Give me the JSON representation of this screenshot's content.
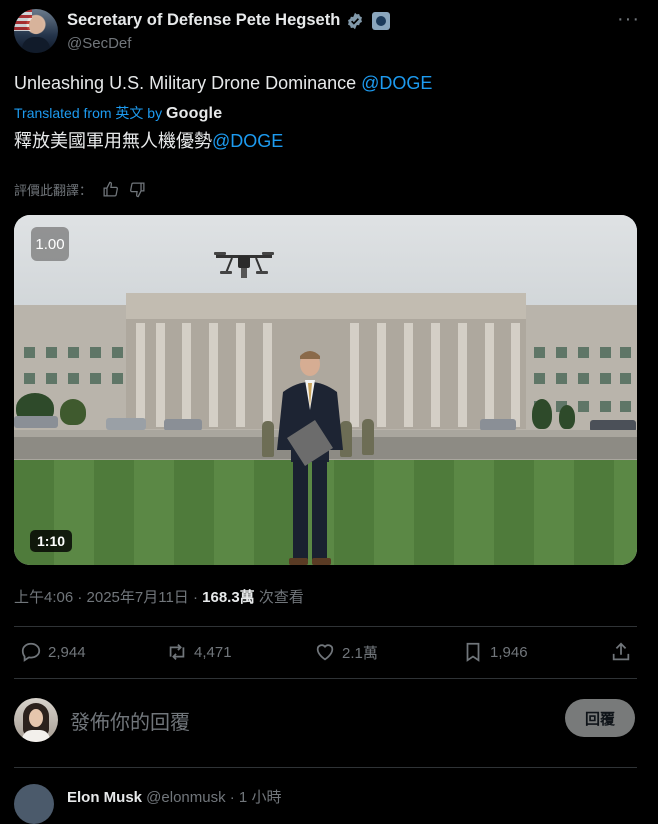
{
  "post": {
    "author_name": "Secretary of Defense Pete Hegseth",
    "author_handle": "@SecDef",
    "more_glyph": "···",
    "text_main": "Unleashing U.S. Military Drone Dominance ",
    "text_mention": "@DOGE",
    "translated_label": "Translated from 英文 by ",
    "translated_brand": "Google",
    "translated_text_main": "釋放美國軍用無人機優勢",
    "translated_text_mention": "@DOGE",
    "rate_label": "評價此翻譯："
  },
  "media": {
    "speed": "1.00",
    "duration": "1:10"
  },
  "meta": {
    "timestamp": "上午4:06 · 2025年7月11日 · ",
    "views_count": "168.3萬",
    "views_label": " 次查看"
  },
  "actions": {
    "replies": "2,944",
    "reposts": "4,471",
    "likes": "2.1萬",
    "bookmarks": "1,946"
  },
  "composer": {
    "placeholder": "發佈你的回覆",
    "reply_button": "回覆"
  },
  "next_reply": {
    "name": "Elon Musk",
    "handle_time": " @elonmusk · 1 小時"
  },
  "colors": {
    "background": "#000000",
    "accent": "#1d9bf0",
    "muted": "#71767b",
    "text": "#e7e9ea"
  }
}
